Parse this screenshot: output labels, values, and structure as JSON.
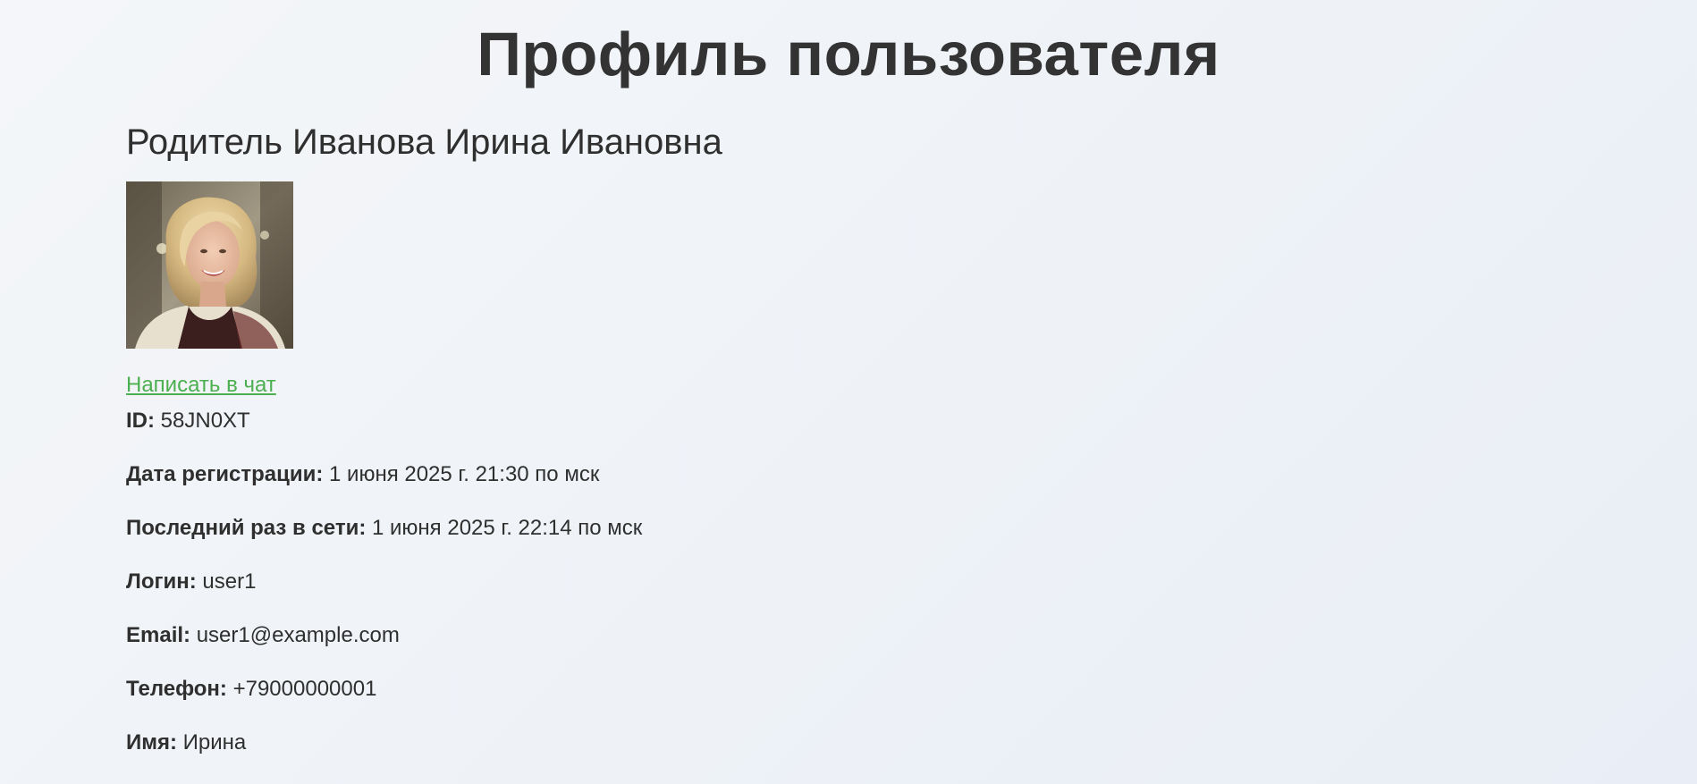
{
  "page": {
    "title": "Профиль пользователя"
  },
  "profile": {
    "display_name": "Родитель Иванова Ирина Ивановна",
    "avatar_alt": "Фото пользователя",
    "chat_link": "Написать в чат",
    "fields": [
      {
        "label": "ID:",
        "value": "58JN0XT"
      },
      {
        "label": "Дата регистрации:",
        "value": "1 июня 2025 г. 21:30 по мск"
      },
      {
        "label": "Последний раз в сети:",
        "value": "1 июня 2025 г. 22:14 по мск"
      },
      {
        "label": "Логин:",
        "value": "user1"
      },
      {
        "label": "Email:",
        "value": "user1@example.com"
      },
      {
        "label": "Телефон:",
        "value": "+79000000001"
      },
      {
        "label": "Имя:",
        "value": "Ирина"
      }
    ]
  },
  "colors": {
    "background": "#f2f5f9",
    "text": "#2f2f2f",
    "link": "#4caf50"
  }
}
